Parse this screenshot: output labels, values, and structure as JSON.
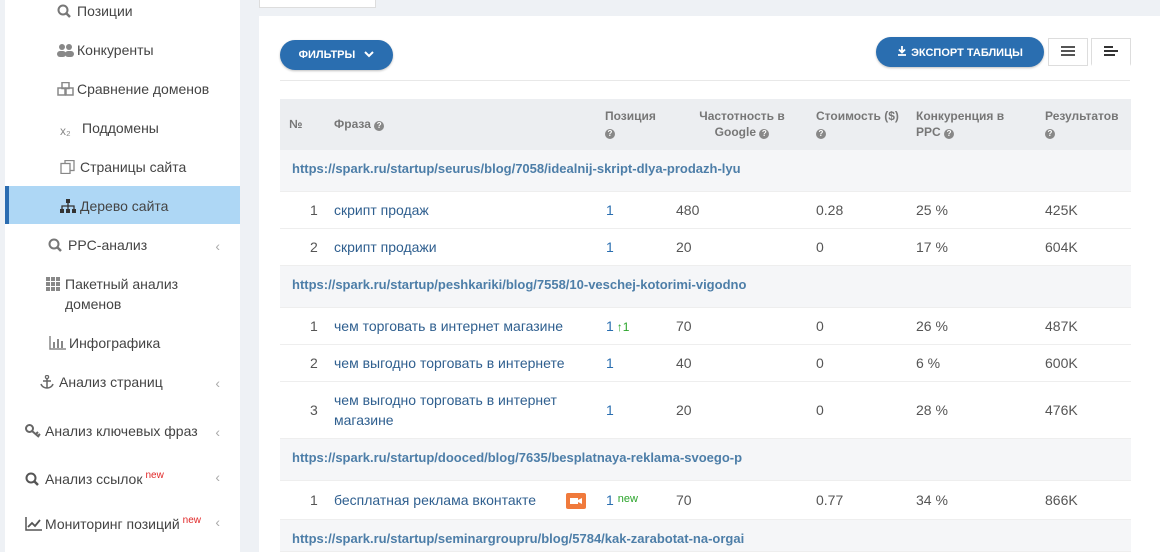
{
  "sidebar": {
    "items": [
      {
        "label": "Позиции",
        "icon": "search-icon"
      },
      {
        "label": "Конкуренты",
        "icon": "users-icon"
      },
      {
        "label": "Сравнение доменов",
        "icon": "cubes-icon"
      },
      {
        "label": "Поддомены",
        "icon": "subscript-icon",
        "icon_text": "x₂"
      },
      {
        "label": "Страницы сайта",
        "icon": "pages-icon"
      },
      {
        "label": "Дерево сайта",
        "icon": "sitemap-icon",
        "active": true
      },
      {
        "label": "PPC-анализ",
        "icon": "search-icon"
      },
      {
        "label": "Пакетный анализ доменов",
        "icon": "grid-icon"
      },
      {
        "label": "Инфографика",
        "icon": "bar-chart-icon"
      },
      {
        "label": "Анализ страниц",
        "icon": "anchor-icon"
      },
      {
        "label": "Анализ ключевых фраз",
        "icon": "key-icon"
      },
      {
        "label": "Анализ ссылок",
        "icon": "search-icon",
        "badge": "new"
      },
      {
        "label": "Мониторинг позиций",
        "icon": "line-chart-icon",
        "badge": "new"
      }
    ],
    "colors": {
      "active_bg": "#aed7f5",
      "active_border": "#2b6cb0"
    }
  },
  "toolbar": {
    "filters_label": "ФИЛЬТРЫ",
    "export_label": "ЭКСПОРТ ТАБЛИЦЫ",
    "accent": "#2a6eb0"
  },
  "table": {
    "headers": {
      "num": "№",
      "phrase": "Фраза",
      "position": "Позиция",
      "frequency": "Частотность в Google",
      "cost": "Стоимость ($)",
      "competition": "Конкуренция в PPC",
      "results": "Результатов"
    },
    "groups": [
      {
        "url": "https://spark.ru/startup/seurus/blog/7058/idealnij-skript-dlya-prodazh-lyu",
        "rows": [
          {
            "n": "1",
            "phrase": "скрипт продаж",
            "position": "1",
            "freq": "480",
            "cost": "0.28",
            "comp": "25 %",
            "results": "425K"
          },
          {
            "n": "2",
            "phrase": "скрипт продажи",
            "position": "1",
            "freq": "20",
            "cost": "0",
            "comp": "17 %",
            "results": "604K"
          }
        ]
      },
      {
        "url": "https://spark.ru/startup/peshkariki/blog/7558/10-veschej-kotorimi-vigodno",
        "rows": [
          {
            "n": "1",
            "phrase": "чем торговать в интернет магазине",
            "position": "1",
            "change": "↑1",
            "freq": "70",
            "cost": "0",
            "comp": "26 %",
            "results": "487K"
          },
          {
            "n": "2",
            "phrase": "чем выгодно торговать в интернете",
            "position": "1",
            "freq": "40",
            "cost": "0",
            "comp": "6 %",
            "results": "600K"
          },
          {
            "n": "3",
            "phrase": "чем выгодно торговать в интернет магазине",
            "position": "1",
            "freq": "20",
            "cost": "0",
            "comp": "28 %",
            "results": "476K"
          }
        ]
      },
      {
        "url": "https://spark.ru/startup/dooced/blog/7635/besplatnaya-reklama-svoego-p",
        "rows": [
          {
            "n": "1",
            "phrase": "бесплатная реклама вконтакте",
            "position": "1",
            "tag": "new",
            "freq": "70",
            "cost": "0.77",
            "comp": "34 %",
            "results": "866K"
          }
        ]
      },
      {
        "url": "https://spark.ru/startup/seminargroupru/blog/5784/kak-zarabotat-na-orgai",
        "rows": []
      }
    ]
  }
}
